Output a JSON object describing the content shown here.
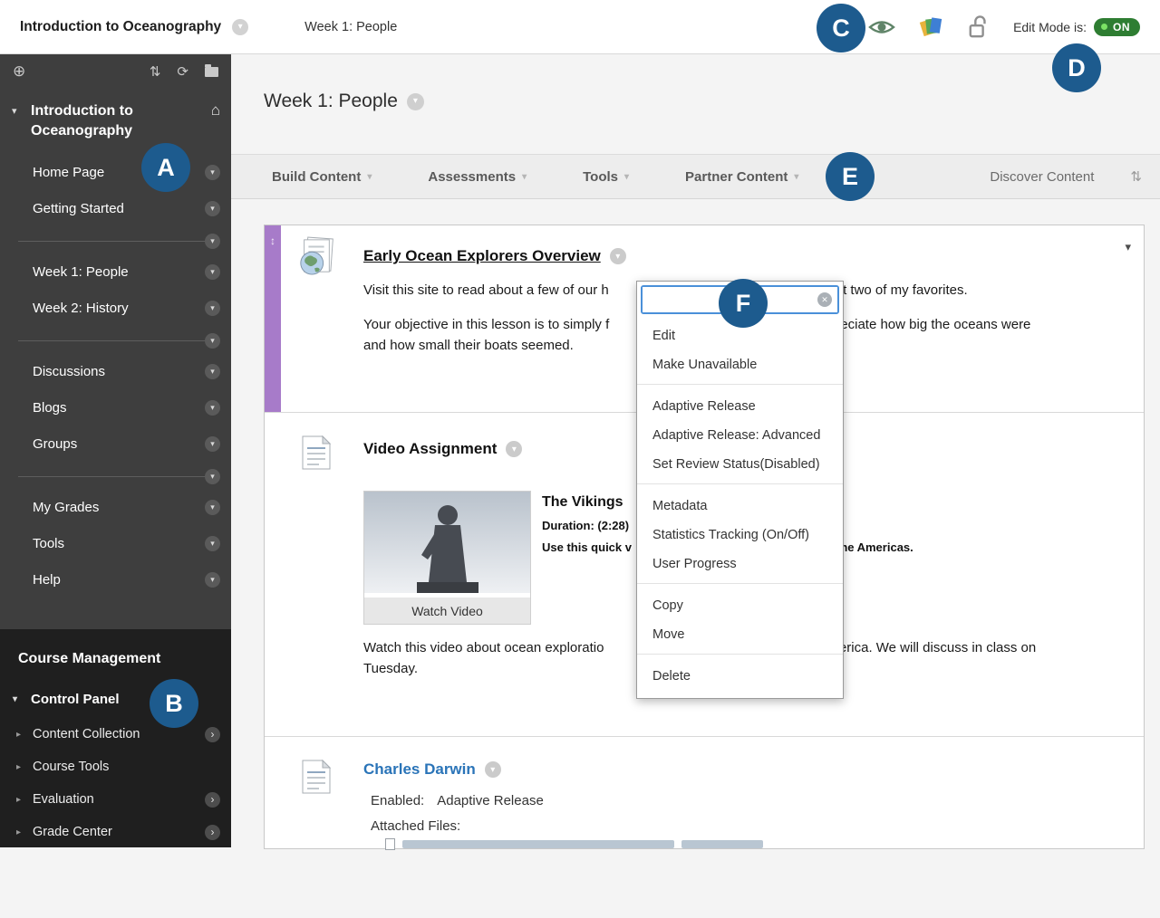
{
  "topbar": {
    "course_title": "Introduction to Oceanography",
    "breadcrumb": "Week 1: People",
    "edit_mode_label": "Edit Mode is:",
    "edit_mode_value": "ON"
  },
  "annotations": {
    "a": "A",
    "b": "B",
    "c": "C",
    "d": "D",
    "e": "E",
    "f": "F"
  },
  "sidebar": {
    "course_name": "Introduction to Oceanography",
    "nav": [
      "Home Page",
      "Getting Started",
      "Week 1: People",
      "Week 2: History",
      "Discussions",
      "Blogs",
      "Groups",
      "My Grades",
      "Tools",
      "Help"
    ],
    "management": {
      "title": "Course Management",
      "control_panel": "Control Panel",
      "items": [
        "Content Collection",
        "Course Tools",
        "Evaluation",
        "Grade Center"
      ]
    }
  },
  "main": {
    "page_title": "Week 1: People",
    "actions": [
      "Build Content",
      "Assessments",
      "Tools",
      "Partner Content"
    ],
    "discover": "Discover Content"
  },
  "items": {
    "explorers": {
      "title": "Early Ocean Explorers Overview",
      "p1_left": "Visit this site to read about a few of our h",
      "p1_right": "about two of my favorites.",
      "p2_left": "Your objective in this lesson is to simply f",
      "p2_right": "appreciate how big the oceans were",
      "p2_line2": "and how small their boats seemed."
    },
    "video": {
      "title": "Video Assignment",
      "caption": "Watch Video",
      "heading": "The Vikings",
      "duration": "Duration: (2:28)",
      "use_left": "Use this quick v",
      "use_right": "the Americas.",
      "desc_left": "Watch this video about ocean exploratio",
      "desc_right": "merica. We will discuss in class on",
      "desc_line2": "Tuesday."
    },
    "darwin": {
      "title": "Charles Darwin",
      "enabled_label": "Enabled:",
      "enabled_value": "Adaptive Release",
      "attached_label": "Attached Files:"
    }
  },
  "context_menu": {
    "search_value": "",
    "groups": [
      [
        "Edit",
        "Make Unavailable"
      ],
      [
        "Adaptive Release",
        "Adaptive Release: Advanced",
        "Set Review Status(Disabled)"
      ],
      [
        "Metadata",
        "Statistics Tracking (On/Off)",
        "User Progress"
      ],
      [
        "Copy",
        "Move"
      ],
      [
        "Delete"
      ]
    ]
  }
}
